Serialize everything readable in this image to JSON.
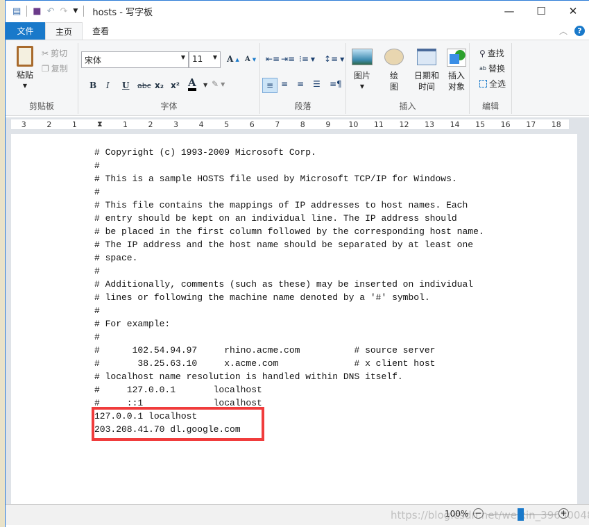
{
  "window": {
    "title": "hosts - 写字板",
    "minimize": "—",
    "maximize": "☐",
    "close": "✕"
  },
  "quick_access": {
    "icons": [
      "wordpad-icon",
      "save-icon",
      "undo-icon",
      "redo-icon",
      "customize-dropdown-icon"
    ]
  },
  "tabs": [
    {
      "label": "文件"
    },
    {
      "label": "主页",
      "active": true
    },
    {
      "label": "查看"
    }
  ],
  "ribbon": {
    "clipboard": {
      "label": "剪贴板",
      "paste": "粘贴",
      "cut": "剪切",
      "copy": "复制"
    },
    "font": {
      "label": "字体",
      "family": "宋体",
      "size": "11",
      "bold": "B",
      "italic": "I",
      "underline": "U",
      "strike": "abc",
      "sub": "x₂",
      "sup": "x²",
      "color": "A"
    },
    "paragraph": {
      "label": "段落"
    },
    "insert": {
      "label": "插入",
      "picture": "图片",
      "paint": "绘图",
      "paint1": "绘",
      "paint2": "图",
      "datetime1": "日期和",
      "datetime2": "时间",
      "object1": "插入",
      "object2": "对象"
    },
    "editing": {
      "label": "编辑",
      "find": "查找",
      "replace": "替换",
      "select_all": "全选"
    }
  },
  "ruler": {
    "ticks": [
      "3",
      "2",
      "1",
      "",
      "1",
      "2",
      "3",
      "4",
      "5",
      "6",
      "7",
      "8",
      "9",
      "10",
      "11",
      "12",
      "13",
      "14",
      "15",
      "16",
      "17",
      "18"
    ]
  },
  "document": {
    "lines": [
      "# Copyright (c) 1993-2009 Microsoft Corp.",
      "#",
      "# This is a sample HOSTS file used by Microsoft TCP/IP for Windows.",
      "#",
      "# This file contains the mappings of IP addresses to host names. Each",
      "# entry should be kept on an individual line. The IP address should",
      "# be placed in the first column followed by the corresponding host name.",
      "# The IP address and the host name should be separated by at least one",
      "# space.",
      "#",
      "# Additionally, comments (such as these) may be inserted on individual",
      "# lines or following the machine name denoted by a '#' symbol.",
      "#",
      "# For example:",
      "#",
      "#      102.54.94.97     rhino.acme.com          # source server",
      "#       38.25.63.10     x.acme.com              # x client host",
      "# localhost name resolution is handled within DNS itself.",
      "#     127.0.0.1       localhost",
      "#     ::1             localhost",
      "127.0.0.1 localhost",
      "203.208.41.70 dl.google.com"
    ],
    "highlight_color": "#f03c3c"
  },
  "status": {
    "zoom": "100%",
    "zoom_level_percent": 100,
    "watermark": "https://blog.csdn.net/weixin_39650048"
  }
}
